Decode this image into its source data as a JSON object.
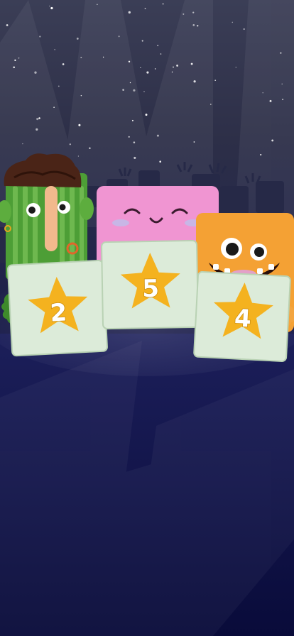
{
  "scene": {
    "colors": {
      "sky_top": "#3b3e56",
      "floor": "#0b0d40",
      "card": "#dcebd9",
      "star": "#f4b21f",
      "green_character": "#4d9e36",
      "pink_character": "#ef8ccf",
      "orange_character": "#f39b2e"
    }
  },
  "scores": [
    {
      "character": "green",
      "value": "2"
    },
    {
      "character": "pink",
      "value": "5"
    },
    {
      "character": "orange",
      "value": "4"
    }
  ]
}
